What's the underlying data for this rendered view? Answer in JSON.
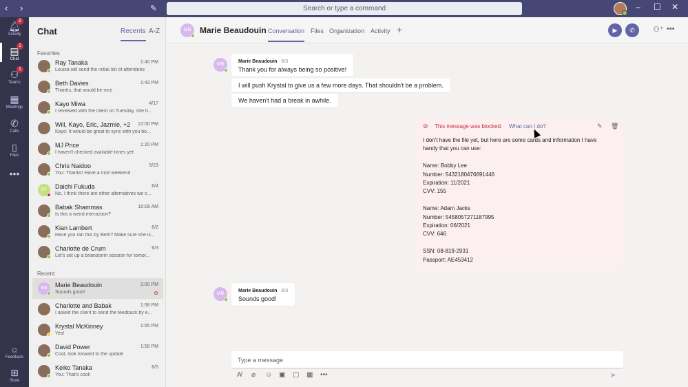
{
  "titlebar": {
    "back_icon": "chevron-left-icon",
    "forward_icon": "chevron-right-icon",
    "search_placeholder": "Search or type a command",
    "window_controls": [
      "minimize-icon",
      "maximize-icon",
      "close-icon"
    ]
  },
  "rail": {
    "items": [
      {
        "label": "Activity",
        "badge": "2",
        "icon": "bell-icon"
      },
      {
        "label": "Chat",
        "badge": "1",
        "icon": "chat-icon"
      },
      {
        "label": "Teams",
        "badge": "1",
        "icon": "teams-icon"
      },
      {
        "label": "Meetings",
        "badge": "",
        "icon": "calendar-icon"
      },
      {
        "label": "Calls",
        "badge": "",
        "icon": "phone-icon"
      },
      {
        "label": "Files",
        "badge": "",
        "icon": "file-icon"
      }
    ],
    "more": "•••",
    "bottom": [
      {
        "label": "Feedback",
        "icon": "lightbulb-icon"
      },
      {
        "label": "Store",
        "icon": "store-icon"
      }
    ]
  },
  "chat_list": {
    "title": "Chat",
    "tabs": [
      "Recents",
      "A-Z"
    ],
    "favorites_label": "Favorites",
    "recent_label": "Recent",
    "favorites": [
      {
        "name": "Ray Tanaka",
        "time": "1:40 PM",
        "preview": "Louisa will send the initial list of attendees",
        "status": "available"
      },
      {
        "name": "Beth Davies",
        "time": "1:43 PM",
        "preview": "Thanks, that would be nice",
        "status": "available"
      },
      {
        "name": "Kayo Miwa",
        "time": "4/17",
        "preview": "I reviewed with the client on Tuesday, she h...",
        "status": "available"
      },
      {
        "name": "Will, Kayo, Eric, Jazmie, +2",
        "time": "12:00 PM",
        "preview": "Kayo: It would be great to sync with you bo...",
        "status": ""
      },
      {
        "name": "MJ Price",
        "time": "1:20 PM",
        "preview": "I haven't checked available times yet",
        "status": "available"
      },
      {
        "name": "Chris Naidoo",
        "time": "5/23",
        "preview": "You: Thanks! Have a nice weekend",
        "status": "available"
      },
      {
        "name": "Daichi Fukuda",
        "time": "6/4",
        "preview": "No, I think there are other alternatives we c...",
        "status": "busy",
        "initials": "DF"
      },
      {
        "name": "Babak Shammas",
        "time": "10:08 AM",
        "preview": "Is this a weird interaction?",
        "status": "available"
      },
      {
        "name": "Kian Lambert",
        "time": "6/2",
        "preview": "Have you ran this by Beth? Make sure she is...",
        "status": "available"
      },
      {
        "name": "Charlotte de Crum",
        "time": "6/3",
        "preview": "Let's set up a brainstorm session for tomor...",
        "status": "available"
      }
    ],
    "recent": [
      {
        "name": "Marie Beaudouin",
        "time": "2:00 PM",
        "preview": "Sounds good!",
        "status": "available",
        "initials": "MB",
        "selected": true
      },
      {
        "name": "Charlotte and Babak",
        "time": "1:58 PM",
        "preview": "I asked the client to send the feedback by e...",
        "status": ""
      },
      {
        "name": "Krystal McKinney",
        "time": "1:55 PM",
        "preview": "Yes!",
        "status": "away"
      },
      {
        "name": "David Power",
        "time": "1:50 PM",
        "preview": "Cool, look forward to the update",
        "status": "available"
      },
      {
        "name": "Keiko Tanaka",
        "time": "6/5",
        "preview": "You: That's cool!",
        "status": "available"
      }
    ]
  },
  "conversation": {
    "contact_initials": "MB",
    "contact_name": "Marie Beaudouin",
    "tabs": [
      "Conversation",
      "Files",
      "Organization",
      "Activity"
    ],
    "add_tab": "+",
    "messages": [
      {
        "sender": "Marie Beaudouin",
        "date": "6/3",
        "lines": [
          "Thank you for always being so positive!"
        ]
      },
      {
        "sender": "",
        "date": "",
        "lines": [
          "I will push Krystal to give us a few more days. That shouldn't be a problem."
        ]
      },
      {
        "sender": "",
        "date": "",
        "lines": [
          "We haven't had a break in awhile."
        ]
      }
    ],
    "blocked": {
      "warning": "This message was blocked.",
      "help_link": "What can I do?",
      "body": [
        "I don't have the file yet, but here are some cards and information I have",
        "handy that you can use:",
        "",
        "Name: Bobby Lee",
        "Number: 5432180476691446",
        "Expiration: 11/2021",
        "CVV: 155",
        "",
        "Name: Adam Jacks",
        "Number: 5458057271187995",
        "Expiration: 06/2021",
        "CVV: 646",
        "",
        "SSN: 08-819-2931",
        "Passport: AE453412"
      ]
    },
    "last_message": {
      "sender": "Marie Beaudouin",
      "date": "6/3",
      "text": "Sounds good!"
    },
    "composer_placeholder": "Type a message"
  }
}
